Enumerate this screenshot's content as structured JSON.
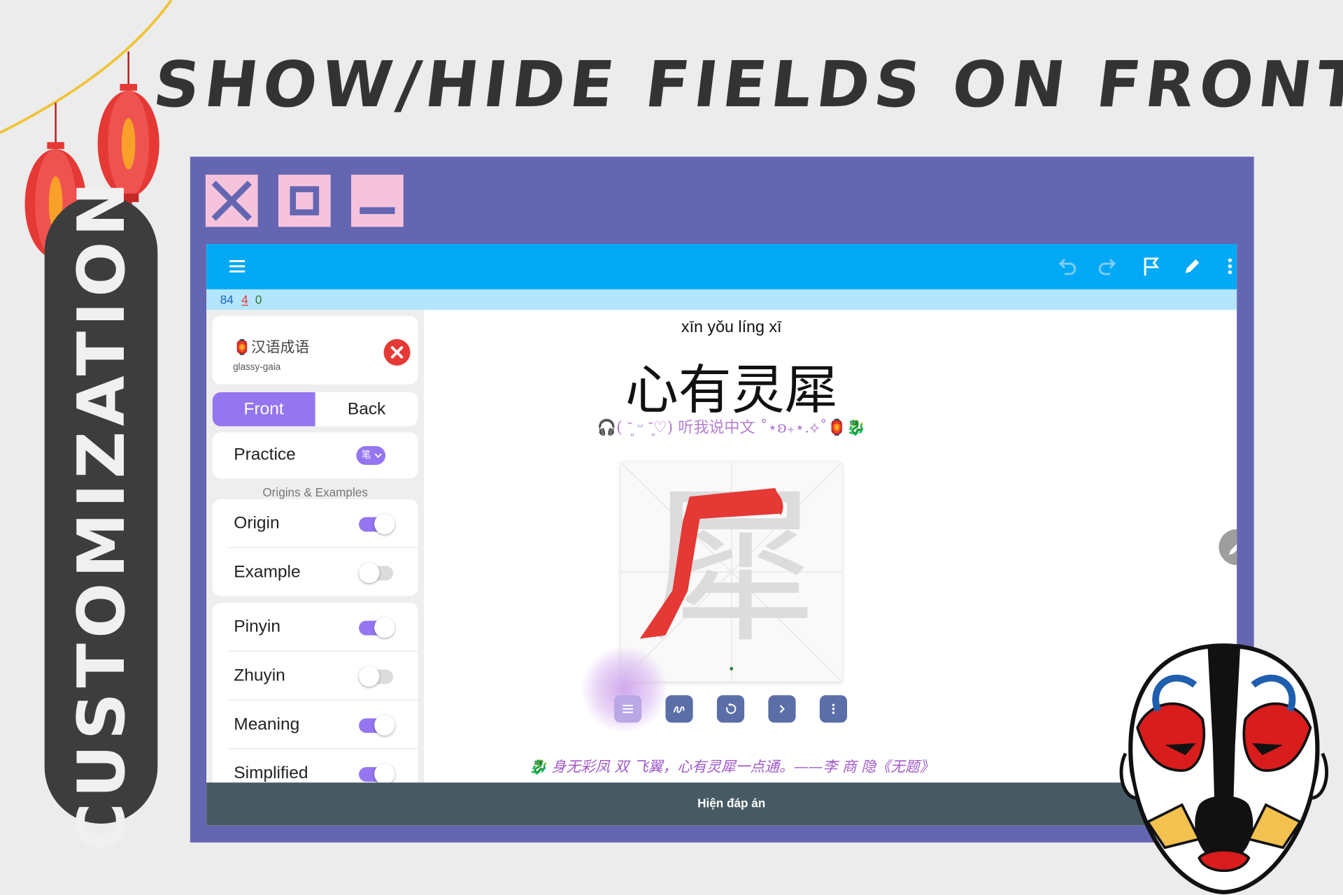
{
  "headline": "SHOW/HIDE FIELDS ON FRONT & BACK",
  "side_label": "CUSTOMIZATION",
  "window_controls": {
    "close": "close",
    "maximize": "maximize",
    "minimize": "minimize"
  },
  "counts": {
    "new": "84",
    "learning": "4",
    "review": "0"
  },
  "deck": {
    "title": "🏮汉语成语",
    "subtitle": "glassy-gaia"
  },
  "tabs": {
    "front": "Front",
    "back": "Back",
    "active": "Front"
  },
  "practice": {
    "label": "Practice",
    "badge": "笔"
  },
  "section_origins": "Origins & Examples",
  "fields": [
    {
      "label": "Origin",
      "on": true
    },
    {
      "label": "Example",
      "on": false
    },
    {
      "label": "Pinyin",
      "on": true
    },
    {
      "label": "Zhuyin",
      "on": false
    },
    {
      "label": "Meaning",
      "on": true
    },
    {
      "label": "Simplified",
      "on": true
    }
  ],
  "card": {
    "pinyin": "xīn yǒu líng xī",
    "hanzi": "心有灵犀",
    "tagline": "🎧( ˘͈ ᵕ ˘͈♡) 听我说中文 ˚⋆ʚ₊⋆.⟡˚🏮🐉",
    "stroke_char": "犀",
    "quote": "🐉 身无彩凤 双 飞翼，心有灵犀一点通。——李 商 隐《无题》"
  },
  "show_answer": "Hiện đáp án",
  "colors": {
    "accent": "#9575f0",
    "toolbar": "#03a9f4",
    "window": "#6466b1",
    "stroke_red": "#e53935"
  }
}
